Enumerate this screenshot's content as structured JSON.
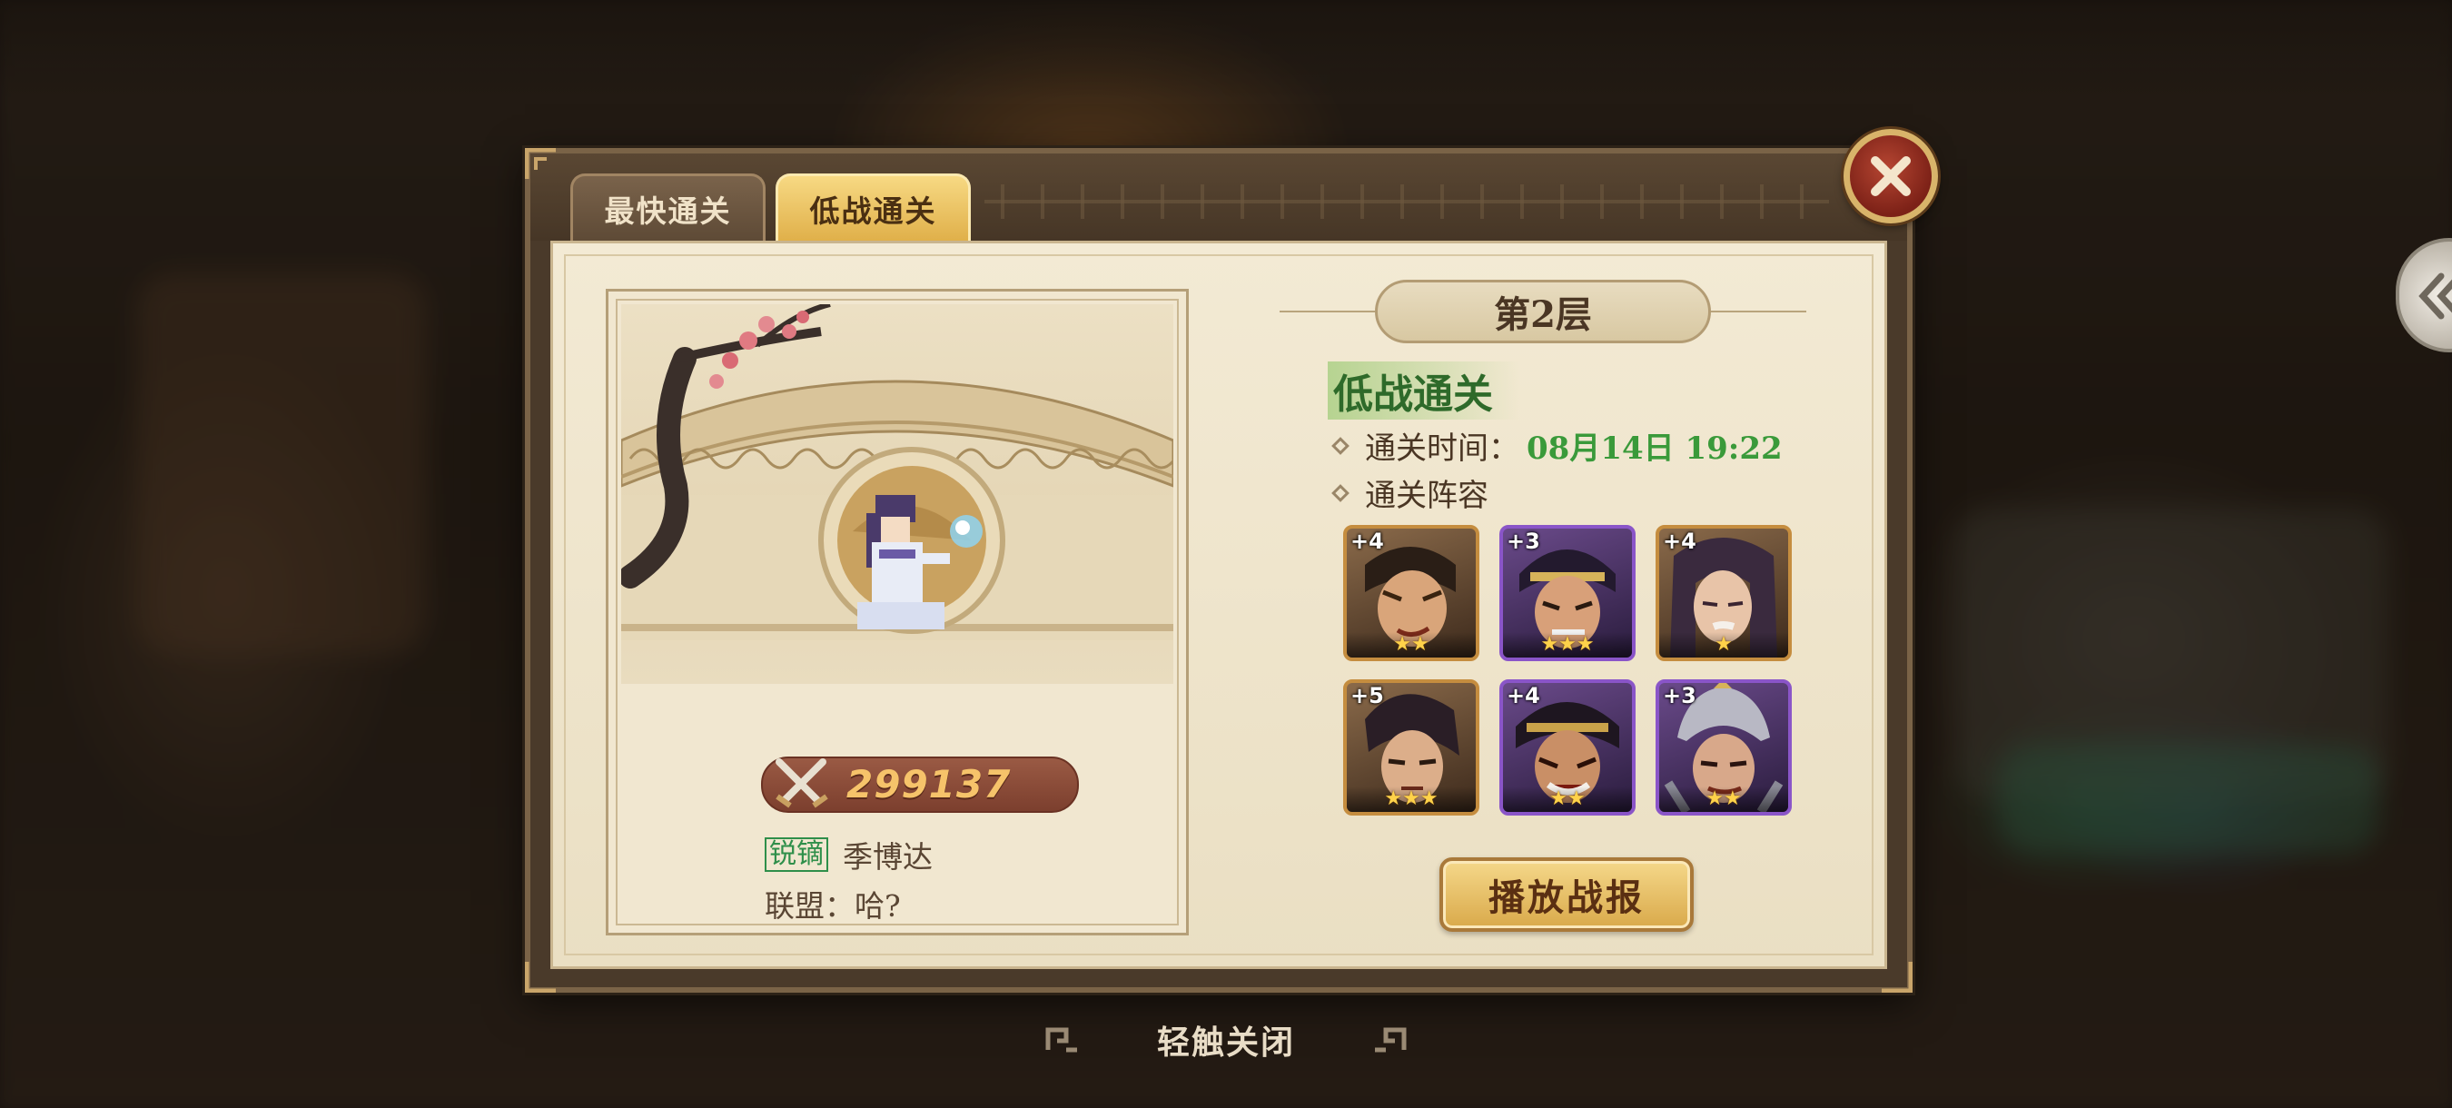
{
  "tabs": [
    {
      "label": "最快通关",
      "active": false
    },
    {
      "label": "低战通关",
      "active": true
    }
  ],
  "record": {
    "power": "299137",
    "player_title": "锐镝",
    "player_name": "季博达",
    "alliance_label": "联盟：",
    "alliance_value": "哈?"
  },
  "detail": {
    "floor": "第2层",
    "mode_heading": "低战通关",
    "clear_time_label": "通关时间：",
    "clear_time_value": "08月14日 19:22",
    "lineup_label": "通关阵容"
  },
  "heroes": [
    {
      "plus": "+4",
      "stars": "★★",
      "frame": "gold"
    },
    {
      "plus": "+3",
      "stars": "★★★",
      "frame": "purple"
    },
    {
      "plus": "+4",
      "stars": "★",
      "frame": "gold"
    },
    {
      "plus": "+5",
      "stars": "★★★",
      "frame": "gold"
    },
    {
      "plus": "+4",
      "stars": "★★",
      "frame": "purple"
    },
    {
      "plus": "+3",
      "stars": "★★",
      "frame": "purple"
    }
  ],
  "replay_button": "播放战报",
  "tap_to_close": "轻触关闭",
  "colors": {
    "accent_gold": "#e0b04a",
    "time_green": "#3a9a3a",
    "close_red": "#9c2f22"
  }
}
